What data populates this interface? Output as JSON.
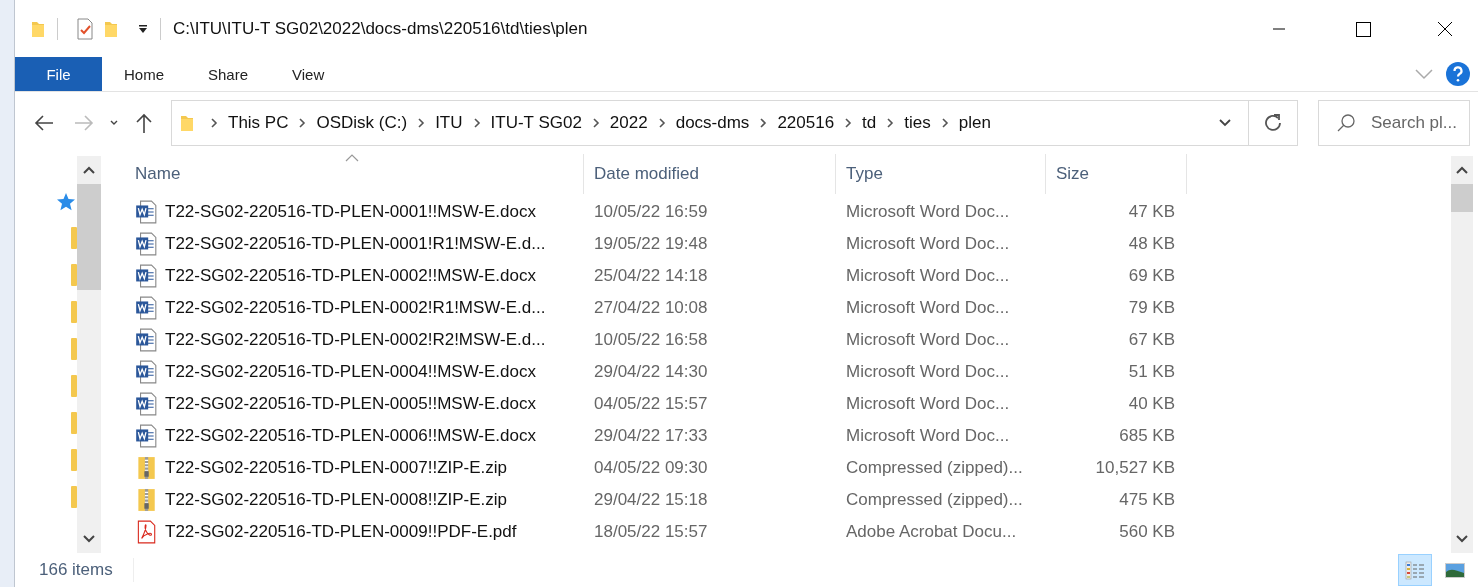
{
  "window": {
    "title": "C:\\ITU\\ITU-T SG02\\2022\\docs-dms\\220516\\td\\ties\\plen"
  },
  "ribbon_tabs": [
    {
      "label": "File",
      "selected": true
    },
    {
      "label": "Home",
      "selected": false
    },
    {
      "label": "Share",
      "selected": false
    },
    {
      "label": "View",
      "selected": false
    }
  ],
  "breadcrumb": [
    "This PC",
    "OSDisk (C:)",
    "ITU",
    "ITU-T SG02",
    "2022",
    "docs-dms",
    "220516",
    "td",
    "ties",
    "plen"
  ],
  "search": {
    "placeholder": "Search pl..."
  },
  "table": {
    "columns": [
      "Name",
      "Date modified",
      "Type",
      "Size"
    ],
    "rows": [
      {
        "kind": "word",
        "name": "T22-SG02-220516-TD-PLEN-0001!!MSW-E.docx",
        "date": "10/05/22 16:59",
        "type": "Microsoft Word Doc...",
        "size": "47 KB"
      },
      {
        "kind": "word",
        "name": "T22-SG02-220516-TD-PLEN-0001!R1!MSW-E.d...",
        "date": "19/05/22 19:48",
        "type": "Microsoft Word Doc...",
        "size": "48 KB"
      },
      {
        "kind": "word",
        "name": "T22-SG02-220516-TD-PLEN-0002!!MSW-E.docx",
        "date": "25/04/22 14:18",
        "type": "Microsoft Word Doc...",
        "size": "69 KB"
      },
      {
        "kind": "word",
        "name": "T22-SG02-220516-TD-PLEN-0002!R1!MSW-E.d...",
        "date": "27/04/22 10:08",
        "type": "Microsoft Word Doc...",
        "size": "79 KB"
      },
      {
        "kind": "word",
        "name": "T22-SG02-220516-TD-PLEN-0002!R2!MSW-E.d...",
        "date": "10/05/22 16:58",
        "type": "Microsoft Word Doc...",
        "size": "67 KB"
      },
      {
        "kind": "word",
        "name": "T22-SG02-220516-TD-PLEN-0004!!MSW-E.docx",
        "date": "29/04/22 14:30",
        "type": "Microsoft Word Doc...",
        "size": "51 KB"
      },
      {
        "kind": "word",
        "name": "T22-SG02-220516-TD-PLEN-0005!!MSW-E.docx",
        "date": "04/05/22 15:57",
        "type": "Microsoft Word Doc...",
        "size": "40 KB"
      },
      {
        "kind": "word",
        "name": "T22-SG02-220516-TD-PLEN-0006!!MSW-E.docx",
        "date": "29/04/22 17:33",
        "type": "Microsoft Word Doc...",
        "size": "685 KB"
      },
      {
        "kind": "zip",
        "name": "T22-SG02-220516-TD-PLEN-0007!!ZIP-E.zip",
        "date": "04/05/22 09:30",
        "type": "Compressed (zipped)...",
        "size": "10,527 KB"
      },
      {
        "kind": "zip",
        "name": "T22-SG02-220516-TD-PLEN-0008!!ZIP-E.zip",
        "date": "29/04/22 15:18",
        "type": "Compressed (zipped)...",
        "size": "475 KB"
      },
      {
        "kind": "pdf",
        "name": "T22-SG02-220516-TD-PLEN-0009!!PDF-E.pdf",
        "date": "18/05/22 15:57",
        "type": "Adobe Acrobat Docu...",
        "size": "560 KB"
      }
    ]
  },
  "status_bar": {
    "count": "166 items"
  },
  "view_buttons": [
    {
      "kind": "details",
      "selected": true
    },
    {
      "kind": "large-icons",
      "selected": false
    }
  ]
}
